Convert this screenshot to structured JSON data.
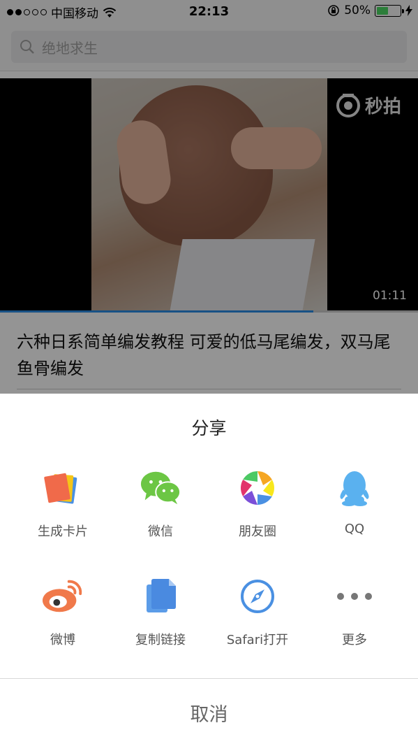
{
  "status_bar": {
    "carrier": "中国移动",
    "time": "22:13",
    "battery_percent": "50%",
    "battery_level": 0.5,
    "battery_color": "#4cd964"
  },
  "search": {
    "placeholder": "绝地求生"
  },
  "video": {
    "watermark": "秒拍",
    "duration": "01:11",
    "progress": 0.75,
    "progress_color": "#2a8ce6"
  },
  "article": {
    "title": "六种日系简单编发教程 可爱的低马尾编发，双马尾鱼骨编发"
  },
  "share_sheet": {
    "title": "分享",
    "items": [
      {
        "label": "生成卡片",
        "icon": "card-icon"
      },
      {
        "label": "微信",
        "icon": "wechat-icon"
      },
      {
        "label": "朋友圈",
        "icon": "moments-icon"
      },
      {
        "label": "QQ",
        "icon": "qq-icon"
      },
      {
        "label": "微博",
        "icon": "weibo-icon"
      },
      {
        "label": "复制链接",
        "icon": "copy-link-icon"
      },
      {
        "label": "Safari打开",
        "icon": "safari-icon"
      },
      {
        "label": "更多",
        "icon": "more-icon"
      }
    ],
    "cancel_label": "取消"
  }
}
